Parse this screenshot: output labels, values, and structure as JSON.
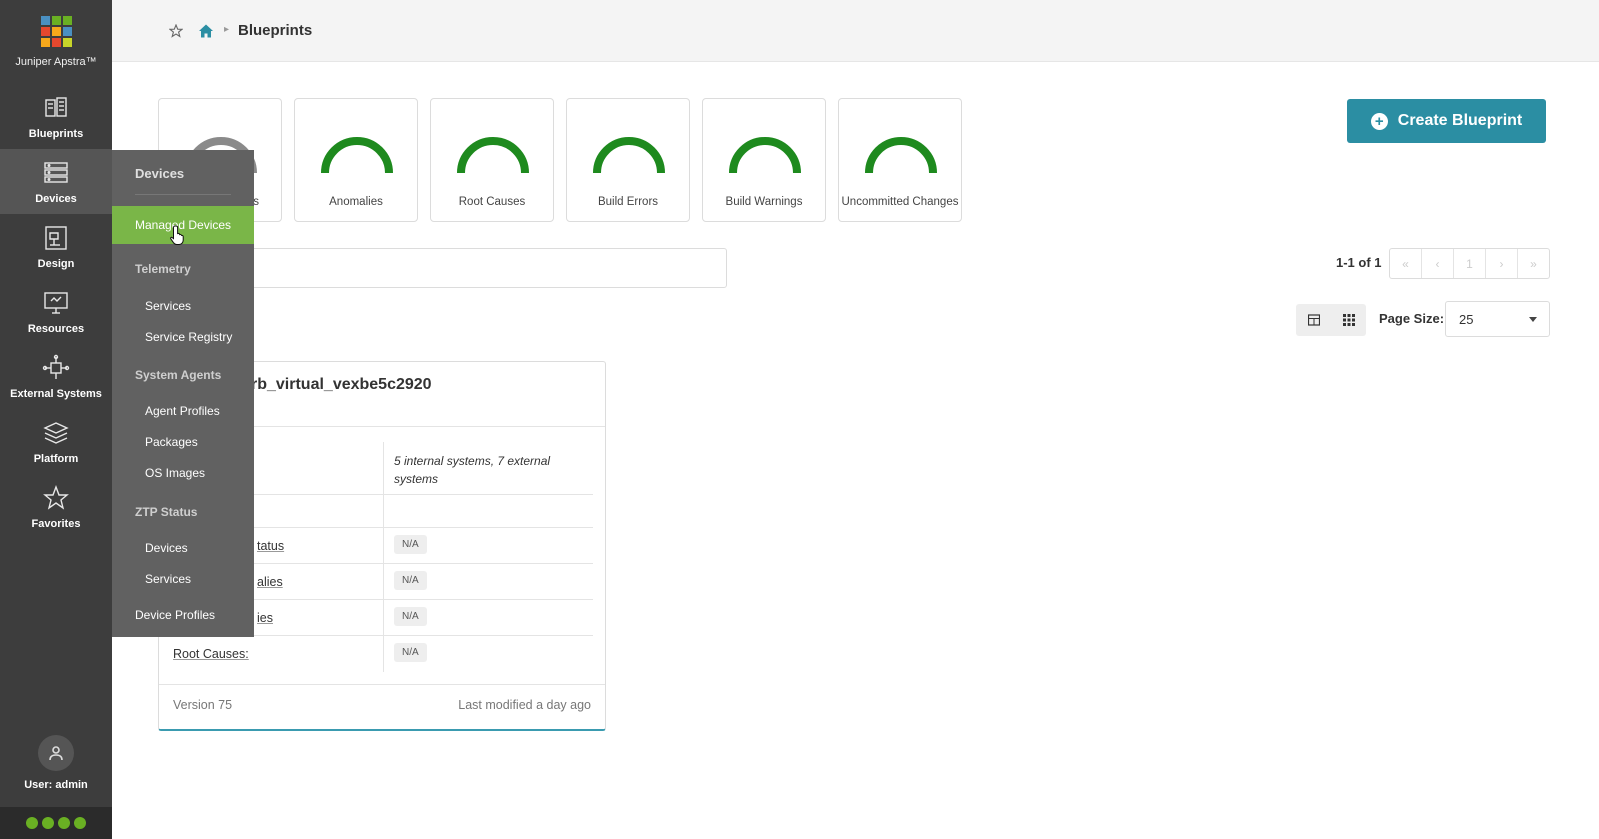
{
  "nav": {
    "brand": "Juniper Apstra™",
    "logo_colors": [
      "#4a90c2",
      "#6ab023",
      "#6ab023",
      "#e6482e",
      "#f7a81b",
      "#4a90c2",
      "#f7a81b",
      "#e6482e",
      "#c8d52a"
    ],
    "items": [
      {
        "label": "Blueprints",
        "icon": "blueprints-icon"
      },
      {
        "label": "Devices",
        "icon": "devices-icon"
      },
      {
        "label": "Design",
        "icon": "design-icon"
      },
      {
        "label": "Resources",
        "icon": "resources-icon"
      },
      {
        "label": "External Systems",
        "icon": "external-systems-icon"
      },
      {
        "label": "Platform",
        "icon": "platform-icon"
      },
      {
        "label": "Favorites",
        "icon": "star-icon"
      }
    ],
    "user": "User: admin",
    "status_color": "#6ab023"
  },
  "header": {
    "breadcrumb_title": "Blueprints"
  },
  "status_cards": [
    {
      "label": "cus",
      "color": "#8a8a8a"
    },
    {
      "label": "Anomalies",
      "color": "#1e8a1e"
    },
    {
      "label": "Root Causes",
      "color": "#1e8a1e"
    },
    {
      "label": "Build Errors",
      "color": "#1e8a1e"
    },
    {
      "label": "Build Warnings",
      "color": "#1e8a1e"
    },
    {
      "label": "Uncommitted Changes",
      "color": "#1e8a1e"
    }
  ],
  "create_button": {
    "label": "Create Blueprint",
    "color": "#2b8ea3"
  },
  "pagination": {
    "summary": "1-1 of 1",
    "current_page": "1",
    "first": "«",
    "prev": "‹",
    "next": "›",
    "last": "»"
  },
  "page_size": {
    "label": "Page Size:",
    "value": "25"
  },
  "blueprint": {
    "title": "rb_virtual_vexbe5c2920",
    "rows": [
      {
        "key": "",
        "value": "5 internal systems, 7 external systems"
      },
      {
        "key": "",
        "value": ""
      },
      {
        "key": "tatus",
        "value": "N/A"
      },
      {
        "key": "alies",
        "value": "N/A"
      },
      {
        "key": "ies",
        "value": "N/A"
      },
      {
        "key": "Root Causes:",
        "value": "N/A"
      }
    ],
    "version": "Version 75",
    "modified": "Last modified a day ago"
  },
  "flyout": {
    "header": "Devices",
    "active_item": "Managed Devices",
    "sections": [
      {
        "title": "Telemetry",
        "items": [
          "Services",
          "Service Registry"
        ]
      },
      {
        "title": "System Agents",
        "items": [
          "Agent Profiles",
          "Packages",
          "OS Images"
        ]
      },
      {
        "title": "ZTP Status",
        "items": [
          "Devices",
          "Services"
        ]
      }
    ],
    "bottom_item": "Device Profiles"
  }
}
